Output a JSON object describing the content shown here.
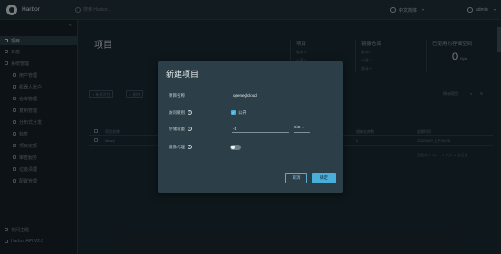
{
  "header": {
    "app_title": "Harbor",
    "search_placeholder": "搜索 Harbor...",
    "language": "中文简体",
    "user": "admin"
  },
  "sidebar": {
    "items": [
      {
        "label": "项目",
        "active": true,
        "icon": "projects-icon"
      },
      {
        "label": "日志",
        "active": false,
        "icon": "logs-icon"
      },
      {
        "label": "系统管理",
        "active": false,
        "icon": "admin-icon"
      },
      {
        "label": "用户管理",
        "active": false,
        "icon": "users-icon"
      },
      {
        "label": "机器人账户",
        "active": false,
        "icon": "robot-icon"
      },
      {
        "label": "仓库管理",
        "active": false,
        "icon": "registry-icon"
      },
      {
        "label": "复制管理",
        "active": false,
        "icon": "replication-icon"
      },
      {
        "label": "分布式分发",
        "active": false,
        "icon": "distribution-icon"
      },
      {
        "label": "标签",
        "active": false,
        "icon": "label-icon"
      },
      {
        "label": "项目定额",
        "active": false,
        "icon": "quota-icon"
      },
      {
        "label": "审查服务",
        "active": false,
        "icon": "scanner-icon"
      },
      {
        "label": "垃圾清理",
        "active": false,
        "icon": "gc-icon"
      },
      {
        "label": "配置管理",
        "active": false,
        "icon": "config-icon"
      }
    ],
    "footer": [
      {
        "label": "夜间主题",
        "icon": "theme-icon"
      },
      {
        "label": "Harbor API V2.0",
        "icon": "api-icon"
      }
    ]
  },
  "main": {
    "page_title": "项目",
    "cards": [
      {
        "title": "项目",
        "rows": [
          "私有  0",
          "公开  1",
          "总计  1"
        ]
      },
      {
        "title": "镜像仓库",
        "rows": [
          "私有  0",
          "公开  0",
          "总计  0"
        ]
      },
      {
        "title": "已使用的存储空间",
        "big": "0",
        "unit": "Byte"
      }
    ],
    "buttons": [
      "+ 新建项目",
      "× 删除"
    ],
    "filter": "所有项目",
    "columns": [
      "项目名称",
      "访问级别",
      "角色",
      "类型",
      "镜像仓库数",
      "创建时间"
    ],
    "row": [
      "library",
      "公开",
      "项目管理员",
      "项目",
      "0",
      "2022/4/20 上午10:05"
    ],
    "pager": "页面大小  15   1 - 1 共计 1 条记录"
  },
  "modal": {
    "title": "新建项目",
    "name_label": "项目名称",
    "name_value": "openeglcloud",
    "access_label": "访问级别",
    "public_label": "公开",
    "quota_label": "存储容量",
    "quota_value": "-1",
    "quota_unit": "GiB",
    "proxy_label": "镜像代理",
    "cancel": "取消",
    "ok": "确定"
  },
  "colors": {
    "accent": "#49afd9",
    "background": "#1b2a32",
    "modal": "#2c3e47"
  }
}
